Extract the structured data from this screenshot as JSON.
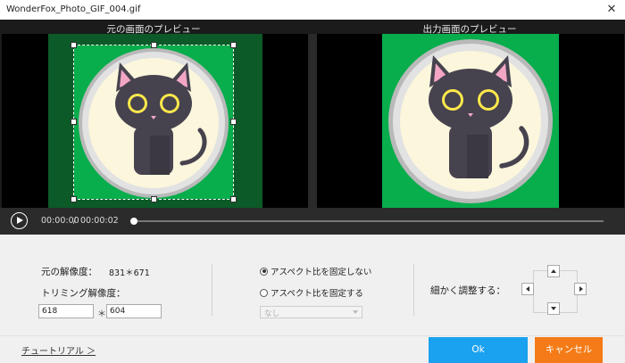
{
  "window": {
    "title": "WonderFox_Photo_GIF_004.gif"
  },
  "preview": {
    "source_label": "元の画面のプレビュー",
    "output_label": "出力画面のプレビュー"
  },
  "playback": {
    "current_time": "00:00:00",
    "separator": "/",
    "duration": "00:00:02",
    "progress": 0
  },
  "settings": {
    "original_resolution_label": "元の解像度：",
    "original_resolution_value": "831＊671",
    "crop_resolution_label": "トリミング解像度：",
    "crop_width": "618",
    "crop_times": "＊",
    "crop_height": "604",
    "aspect_unlocked_label": "アスペクト比を固定しない",
    "aspect_locked_label": "アスペクト比を固定する",
    "aspect_selected": "unlocked",
    "ratio_select_value": "なし",
    "fine_adjust_label": "細かく調整する："
  },
  "footer": {
    "tutorial_link": "チュートリアル ＞",
    "ok_label": "Ok",
    "cancel_label": "キャンセル"
  },
  "colors": {
    "ok_button": "#1aa1ef",
    "cancel_button": "#f47b17",
    "image_green": "#08ad4c",
    "preview_background": "#000000"
  }
}
